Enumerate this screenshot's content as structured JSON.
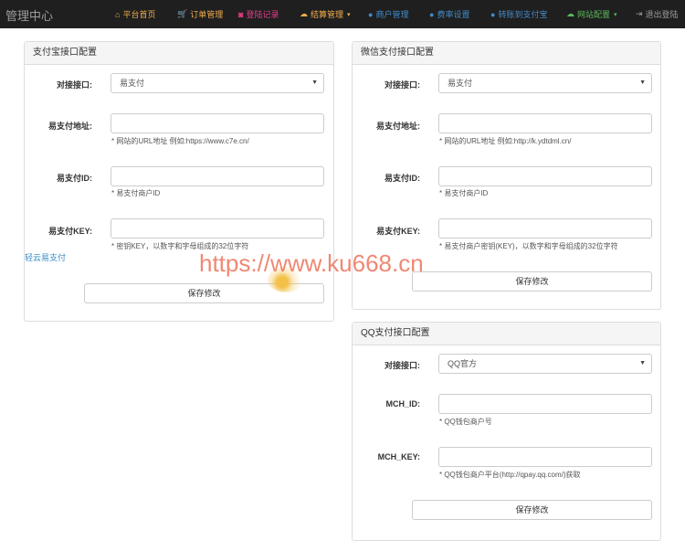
{
  "brand": "管理中心",
  "nav": [
    {
      "icon": "home-icon",
      "glyph": "⌂",
      "label": "平台首页",
      "color": "#f0ad4e",
      "caret": false
    },
    {
      "icon": "cart-icon",
      "glyph": "🛒",
      "label": "订单管理",
      "color": "#f0ad4e",
      "caret": false
    },
    {
      "icon": "camera-icon",
      "glyph": "◙",
      "label": "登陆记录",
      "color": "#e83e8c",
      "caret": false
    },
    {
      "icon": "cloud-icon",
      "glyph": "☁",
      "label": "结算管理",
      "color": "#f0ad4e",
      "caret": true
    },
    {
      "icon": "user-icon",
      "glyph": "●",
      "label": "商户管理",
      "color": "#428bca",
      "caret": false
    },
    {
      "icon": "user-icon",
      "glyph": "●",
      "label": "费率设置",
      "color": "#428bca",
      "caret": false
    },
    {
      "icon": "user-icon",
      "glyph": "●",
      "label": "转账到支付宝",
      "color": "#428bca",
      "caret": false
    },
    {
      "icon": "cloud-icon",
      "glyph": "☁",
      "label": "网站配置",
      "color": "#5cb85c",
      "caret": true
    },
    {
      "icon": "logout-icon",
      "glyph": "⇥",
      "label": "退出登陆",
      "color": "#9d9d9d",
      "caret": false
    }
  ],
  "alipay": {
    "title": "支付宝接口配置",
    "iface_label": "对接接口:",
    "iface_value": "易支付",
    "url_label": "易支付地址:",
    "url_value": "",
    "url_help": "* 网站的URL地址 例如:https://www.c7e.cn/",
    "id_label": "易支付ID:",
    "id_value": "",
    "id_help": "* 易支付商户ID",
    "key_label": "易支付KEY:",
    "key_value": "",
    "key_help": "* 密钥KEY，以数字和字母组成的32位字符",
    "save": "保存修改"
  },
  "ext_link": "轻云易支付",
  "wechat": {
    "title": "微信支付接口配置",
    "iface_label": "对接接口:",
    "iface_value": "易支付",
    "url_label": "易支付地址:",
    "url_value": "",
    "url_help": "* 网站的URL地址 例如:http://k.ydtdml.cn/",
    "id_label": "易支付ID:",
    "id_value": "",
    "id_help": "* 易支付商户ID",
    "key_label": "易支付KEY:",
    "key_value": "",
    "key_help": "* 易支付商户密钥(KEY)，以数字和字母组成的32位字符",
    "save": "保存修改"
  },
  "qq": {
    "title": "QQ支付接口配置",
    "iface_label": "对接接口:",
    "iface_value": "QQ官方",
    "mch_id_label": "MCH_ID:",
    "mch_id_value": "",
    "mch_id_help": "* QQ钱包商户号",
    "mch_key_label": "MCH_KEY:",
    "mch_key_value": "",
    "mch_key_help": "* QQ钱包商户平台(http://qpay.qq.com/)获取",
    "save": "保存修改"
  },
  "watermark": "https://www.ku668.cn"
}
